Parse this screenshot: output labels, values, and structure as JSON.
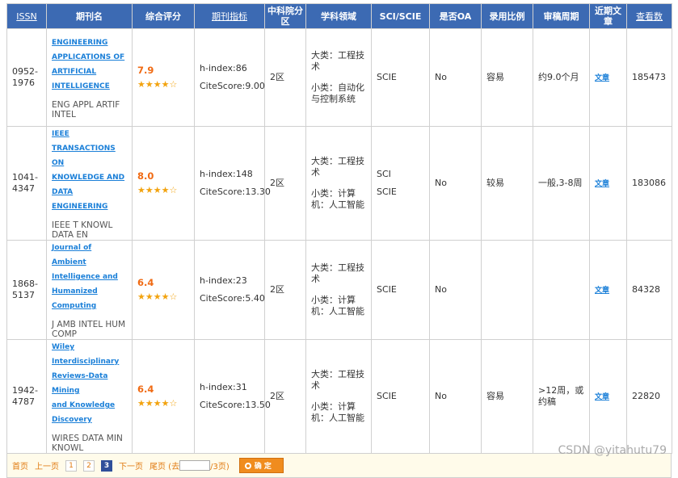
{
  "header": {
    "issn": "ISSN",
    "journal": "期刊名",
    "score": "综合评分",
    "metrics": "期刊指标",
    "cas_zone": "中科院分区",
    "field": "学科领域",
    "sci": "SCI/SCIE",
    "oa": "是否OA",
    "acceptance": "录用比例",
    "review": "审稿周期",
    "recent": "近期文章",
    "views": "查看数"
  },
  "rows": [
    {
      "issn": "0952-1976",
      "title_lines": [
        "ENGINEERING",
        "APPLICATIONS OF",
        "ARTIFICIAL",
        "INTELLIGENCE"
      ],
      "abbr": "ENG APPL ARTIF INTEL",
      "score": "7.9",
      "stars": "★★★★☆",
      "h_index": "h-index:86",
      "citescore": "CiteScore:9.00",
      "zone": "2区",
      "major": "大类：工程技术",
      "minor": "小类：自动化与控制系统",
      "sci": [
        "SCIE"
      ],
      "oa": "No",
      "acceptance": "容易",
      "review": "约9.0个月",
      "article": "文章",
      "views": "185473"
    },
    {
      "issn": "1041-4347",
      "title_lines": [
        "IEEE",
        "TRANSACTIONS ON",
        "KNOWLEDGE AND",
        "DATA ENGINEERING"
      ],
      "abbr": "IEEE T KNOWL DATA EN",
      "score": "8.0",
      "stars": "★★★★☆",
      "h_index": "h-index:148",
      "citescore": "CiteScore:13.30",
      "zone": "2区",
      "major": "大类：工程技术",
      "minor": "小类：计算机：人工智能",
      "sci": [
        "SCI",
        "SCIE"
      ],
      "oa": "No",
      "acceptance": "较易",
      "review": "一般,3-8周",
      "article": "文章",
      "views": "183086"
    },
    {
      "issn": "1868-5137",
      "title_lines": [
        "Journal of Ambient",
        "Intelligence and",
        "Humanized",
        "Computing"
      ],
      "abbr": "J AMB INTEL HUM COMP",
      "score": "6.4",
      "stars": "★★★★☆",
      "h_index": "h-index:23",
      "citescore": "CiteScore:5.40",
      "zone": "2区",
      "major": "大类：工程技术",
      "minor": "小类：计算机：人工智能",
      "sci": [
        "SCIE"
      ],
      "oa": "No",
      "acceptance": "",
      "review": "",
      "article": "文章",
      "views": "84328"
    },
    {
      "issn": "1942-4787",
      "title_lines": [
        "Wiley",
        "Interdisciplinary",
        "Reviews-Data Mining",
        "and Knowledge",
        "Discovery"
      ],
      "abbr": "WIRES DATA MIN KNOWL",
      "score": "6.4",
      "stars": "★★★★☆",
      "h_index": "h-index:31",
      "citescore": "CiteScore:13.50",
      "zone": "2区",
      "major": "大类：工程技术",
      "minor": "小类：计算机：人工智能",
      "sci": [
        "SCIE"
      ],
      "oa": "No",
      "acceptance": "容易",
      "review": ">12周，或约稿",
      "article": "文章",
      "views": "22820"
    }
  ],
  "pager": {
    "first": "首页",
    "prev": "上一页",
    "pages": [
      "1",
      "2",
      "3"
    ],
    "current": "3",
    "next": "下一页",
    "last_prefix": "尾页 (去",
    "last_suffix": "/3页)",
    "ok": "确 定"
  },
  "watermark": "CSDN @yitahutu79"
}
